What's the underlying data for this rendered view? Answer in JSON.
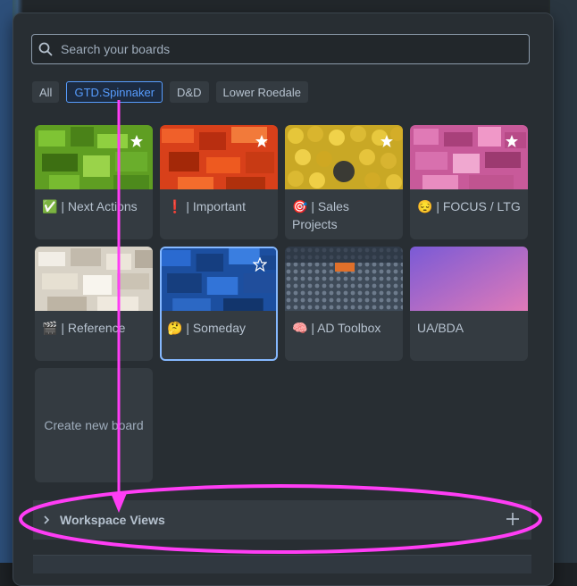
{
  "search": {
    "placeholder": "Search your boards",
    "value": ""
  },
  "filters": [
    {
      "label": "All"
    },
    {
      "label": "GTD.Spinnaker",
      "active": true
    },
    {
      "label": "D&D"
    },
    {
      "label": "Lower Roedale"
    }
  ],
  "boards": [
    {
      "label": "✅ | Next Actions",
      "starred": true,
      "theme": "green-lego"
    },
    {
      "label": "❗ | Important",
      "starred": true,
      "theme": "orange-lego"
    },
    {
      "label": "🎯 | Sales Projects",
      "starred": true,
      "theme": "yellow-minifig-heads"
    },
    {
      "label": "😔 | FOCUS / LTG",
      "starred": true,
      "theme": "pink-lego"
    },
    {
      "label": "🎬 | Reference",
      "starred": false,
      "theme": "white-lego"
    },
    {
      "label": "🤔 | Someday",
      "starred": false,
      "star_outline": true,
      "selected": true,
      "theme": "blue-lego"
    },
    {
      "label": "🧠 | AD Toolbox",
      "starred": false,
      "theme": "grey-baseplate"
    },
    {
      "label": "UA/BDA",
      "starred": false,
      "theme": "purple-pink-gradient"
    }
  ],
  "create_board": {
    "label": "Create new board"
  },
  "workspace_views": {
    "label": "Workspace Views"
  },
  "colors": {
    "accent": "#579dff",
    "annotation": "#ff3df5",
    "panel": "#282e33",
    "tile": "#343b41",
    "text": "#b6c2cf"
  }
}
